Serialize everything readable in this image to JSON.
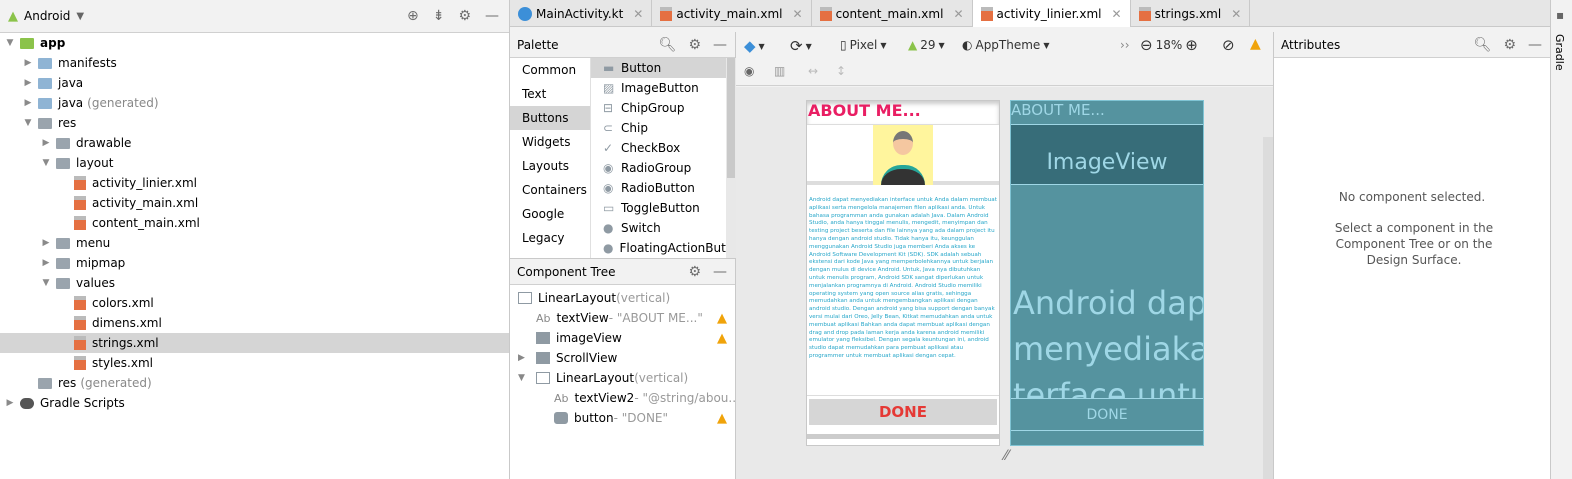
{
  "project": {
    "view": "Android",
    "tree": [
      {
        "label": "app",
        "depth": 0,
        "open": true,
        "kind": "module",
        "bold": true
      },
      {
        "label": "manifests",
        "depth": 1,
        "open": false,
        "kind": "folder"
      },
      {
        "label": "java",
        "depth": 1,
        "open": false,
        "kind": "folder"
      },
      {
        "label": "java",
        "suffix": "(generated)",
        "depth": 1,
        "open": false,
        "kind": "folder"
      },
      {
        "label": "res",
        "depth": 1,
        "open": true,
        "kind": "res"
      },
      {
        "label": "drawable",
        "depth": 2,
        "open": false,
        "kind": "grey"
      },
      {
        "label": "layout",
        "depth": 2,
        "open": true,
        "kind": "grey"
      },
      {
        "label": "activity_linier.xml",
        "depth": 3,
        "kind": "xml"
      },
      {
        "label": "activity_main.xml",
        "depth": 3,
        "kind": "xml"
      },
      {
        "label": "content_main.xml",
        "depth": 3,
        "kind": "xml"
      },
      {
        "label": "menu",
        "depth": 2,
        "open": false,
        "kind": "grey"
      },
      {
        "label": "mipmap",
        "depth": 2,
        "open": false,
        "kind": "grey"
      },
      {
        "label": "values",
        "depth": 2,
        "open": true,
        "kind": "grey"
      },
      {
        "label": "colors.xml",
        "depth": 3,
        "kind": "xml"
      },
      {
        "label": "dimens.xml",
        "depth": 3,
        "kind": "xml"
      },
      {
        "label": "strings.xml",
        "depth": 3,
        "kind": "xml",
        "selected": true
      },
      {
        "label": "styles.xml",
        "depth": 3,
        "kind": "xml"
      },
      {
        "label": "res",
        "suffix": "(generated)",
        "depth": 1,
        "kind": "res"
      },
      {
        "label": "Gradle Scripts",
        "depth": 0,
        "open": false,
        "kind": "gradle"
      }
    ]
  },
  "tabs": [
    {
      "label": "MainActivity.kt",
      "kind": "kt"
    },
    {
      "label": "activity_main.xml"
    },
    {
      "label": "content_main.xml"
    },
    {
      "label": "activity_linier.xml",
      "active": true
    },
    {
      "label": "strings.xml"
    }
  ],
  "palette": {
    "title": "Palette",
    "categories": [
      "Common",
      "Text",
      "Buttons",
      "Widgets",
      "Layouts",
      "Containers",
      "Google",
      "Legacy"
    ],
    "selected_category": "Buttons",
    "items": [
      "Button",
      "ImageButton",
      "ChipGroup",
      "Chip",
      "CheckBox",
      "RadioGroup",
      "RadioButton",
      "ToggleButton",
      "Switch",
      "FloatingActionButton"
    ]
  },
  "component_tree": {
    "title": "Component Tree",
    "nodes": [
      {
        "name": "LinearLayout",
        "detail": "(vertical)",
        "depth": 0,
        "icon": "layout"
      },
      {
        "name": "textView",
        "detail": "- \"ABOUT ME...\"",
        "depth": 1,
        "icon": "Ab",
        "warn": true
      },
      {
        "name": "imageView",
        "detail": "",
        "depth": 1,
        "icon": "image",
        "warn": true
      },
      {
        "name": "ScrollView",
        "detail": "",
        "depth": 1,
        "icon": "scroll",
        "arrow": "▶"
      },
      {
        "name": "LinearLayout",
        "detail": "(vertical)",
        "depth": 1,
        "icon": "layout",
        "arrow": "▼"
      },
      {
        "name": "textView2",
        "detail": "- \"@string/abou...",
        "depth": 2,
        "icon": "Ab"
      },
      {
        "name": "button",
        "detail": "- \"DONE\"",
        "depth": 2,
        "icon": "button",
        "warn": true
      }
    ]
  },
  "toolbar": {
    "device": "Pixel",
    "api": "29",
    "theme": "AppTheme",
    "zoom": "18%"
  },
  "design": {
    "title": "ABOUT ME...",
    "body": "Android dapat menyediakan interface untuk Anda dalam membuat aplikasi serta mengelola manajemen filen aplikasi anda. Untuk bahasa programman anda gunakan adalah Java. Dalam Android Studio, anda hanya tinggal menulis, mengedit, menyimpan dan testing project beserta dan file lainnya yang ada dalam project itu hanya dengan android studio. Tidak hanya itu, keunggulan menggunakan Android Studio juga memberi Anda akses ke Android Software Development Kit (SDK). SDK adalah sebuah ekstensi dari kode Java yang memperbolehkannya untuk berjalan dengan mulus di device Android. Untuk, Java nya dibutuhkan untuk menulis program, Android SDK sangat diperlukan untuk menjalankan programnya di Android. Android Studio memiliki operating system yang open source alias gratis, sehingga memudahkan anda untuk mengembangkan aplikasi dengan android studio. Dengan android yang bisa support dengan banyak versi mulai dari Oreo, Jelly Bean, Kitkat memudahkan anda untuk membuat aplikasi Bahkan anda dapat membuat aplikasi dengan drag and drop pada laman kerja anda karena android memiliki emulator yang fleksibel. Dengan segala keuntungan ini, android studio dapat memudahkan para pembuat aplikasi atau programmer untuk membuat aplikasi dengan cepat.",
    "button": "DONE"
  },
  "blueprint": {
    "title": "ABOUT ME...",
    "image": "ImageView",
    "body": "Android dapat menyediakan interface untuk",
    "button": "DONE"
  },
  "attributes": {
    "title": "Attributes",
    "empty": "No component selected.",
    "hint": "Select a component in the Component Tree or on the Design Surface."
  },
  "side": {
    "gradle": "Gradle"
  },
  "colors": {
    "accent": "#e91e63",
    "button_text": "#e53935",
    "body_text": "#26a6c9",
    "blueprint": "#55939f"
  }
}
